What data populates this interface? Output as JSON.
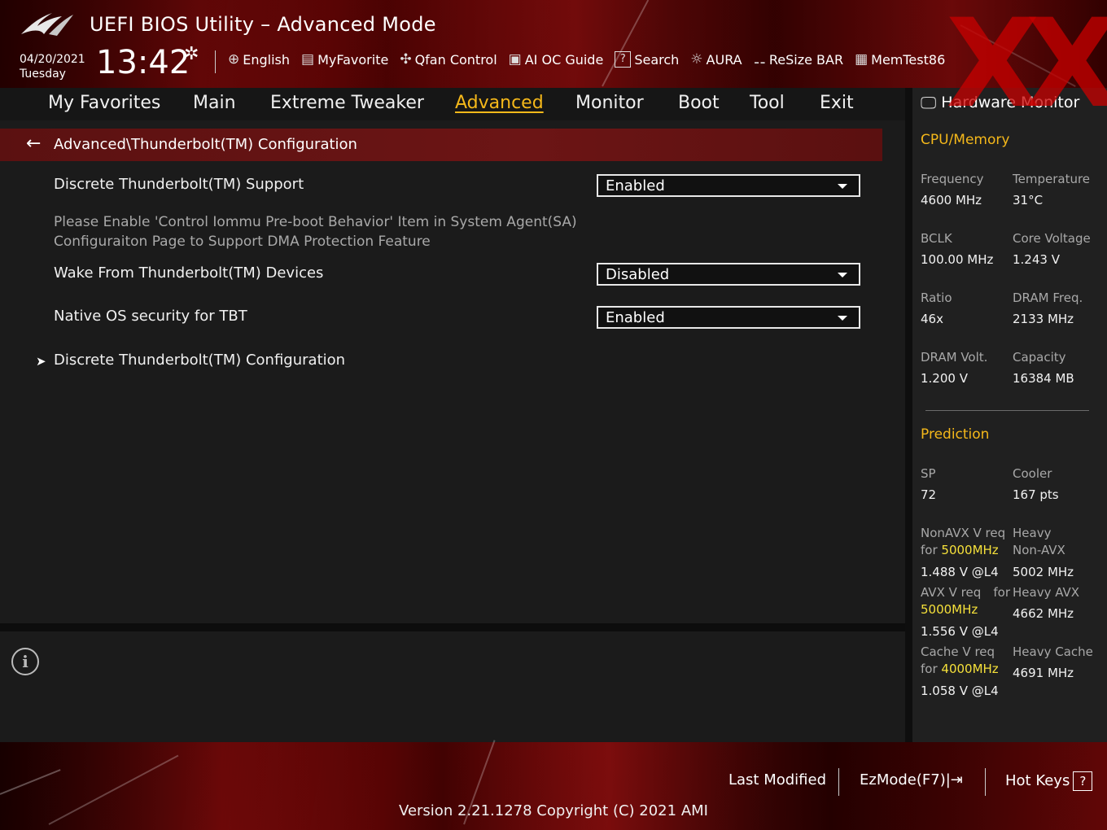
{
  "header": {
    "title": "UEFI BIOS Utility – Advanced Mode",
    "date": "04/20/2021",
    "day": "Tuesday",
    "time": "13:42",
    "watermark": "XX",
    "toolbar": [
      {
        "label": "English",
        "icon": "globe-icon"
      },
      {
        "label": "MyFavorite",
        "icon": "favorite-list-icon"
      },
      {
        "label": "Qfan Control",
        "icon": "fan-icon"
      },
      {
        "label": "AI OC Guide",
        "icon": "ai-chip-icon"
      },
      {
        "label": "Search",
        "icon": "help-search-icon"
      },
      {
        "label": "AURA",
        "icon": "aura-light-icon"
      },
      {
        "label": "ReSize BAR",
        "icon": "resize-bar-icon"
      },
      {
        "label": "MemTest86",
        "icon": "memory-icon"
      }
    ]
  },
  "nav": {
    "tabs": [
      "My Favorites",
      "Main",
      "Extreme Tweaker",
      "Advanced",
      "Monitor",
      "Boot",
      "Tool",
      "Exit"
    ],
    "active": "Advanced"
  },
  "content": {
    "path": "Advanced\\Thunderbolt(TM) Configuration",
    "rows": [
      {
        "label": "Discrete Thunderbolt(TM) Support",
        "value": "Enabled"
      },
      {
        "help_line1": "Please Enable 'Control Iommu Pre-boot Behavior' Item in System Agent(SA)",
        "help_line2": "Configuraiton Page to Support DMA Protection Feature"
      },
      {
        "label": "Wake From Thunderbolt(TM) Devices",
        "value": "Disabled"
      },
      {
        "label": "Native OS security for TBT",
        "value": "Enabled"
      },
      {
        "label": "Discrete Thunderbolt(TM) Configuration"
      }
    ]
  },
  "hw": {
    "title": "Hardware Monitor",
    "cpu_section": "CPU/Memory",
    "cpu": [
      {
        "l1": "Frequency",
        "v1": "4600 MHz",
        "l2": "Temperature",
        "v2": "31°C"
      },
      {
        "l1": "BCLK",
        "v1": "100.00 MHz",
        "l2": "Core Voltage",
        "v2": "1.243 V"
      },
      {
        "l1": "Ratio",
        "v1": "46x",
        "l2": "DRAM Freq.",
        "v2": "2133 MHz"
      },
      {
        "l1": "DRAM Volt.",
        "v1": "1.200 V",
        "l2": "Capacity",
        "v2": "16384 MB"
      }
    ],
    "pred_section": "Prediction",
    "sp_label": "SP",
    "sp_value": "72",
    "cooler_label": "Cooler",
    "cooler_value": "167 pts",
    "nonavx_label": "NonAVX V req",
    "nonavx_for": "for",
    "nonavx_freq": "5000MHz",
    "nonavx_value": "1.488 V @L4",
    "heavy_nonavx_label1": "Heavy",
    "heavy_nonavx_label2": "Non-AVX",
    "heavy_nonavx_value": "5002 MHz",
    "avx_label": "AVX V req",
    "avx_for": "for",
    "avx_freq": "5000MHz",
    "avx_value": "1.556 V @L4",
    "heavy_avx_label": "Heavy AVX",
    "heavy_avx_value": "4662 MHz",
    "cache_label": "Cache V req",
    "cache_for": "for",
    "cache_freq": "4000MHz",
    "cache_value": "1.058 V @L4",
    "heavy_cache_label": "Heavy Cache",
    "heavy_cache_value": "4691 MHz"
  },
  "footer": {
    "last_modified": "Last Modified",
    "ezmode": "EzMode(F7)|",
    "hotkeys": "Hot Keys",
    "hotkeys_key": "?",
    "version": "Version 2.21.1278 Copyright (C) 2021 AMI"
  },
  "colors": {
    "accent": "#f5b81a",
    "highlight": "#f5e03a",
    "path_bar": "#661313",
    "brand_red": "#a10f0f"
  }
}
